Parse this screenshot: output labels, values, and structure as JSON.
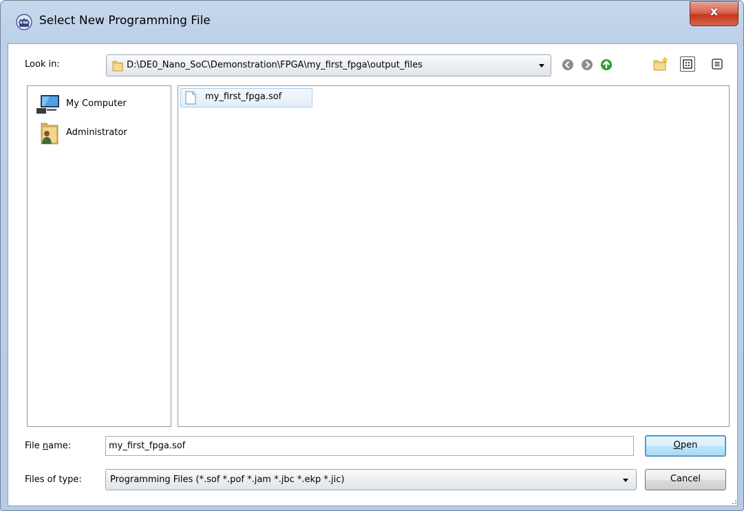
{
  "window": {
    "title": "Select New Programming File",
    "close_glyph": "x"
  },
  "toolbar": {
    "look_in_label": "Look in:",
    "path": "D:\\DE0_Nano_SoC\\Demonstration\\FPGA\\my_first_fpga\\output_files",
    "nav_icons": [
      "back-icon",
      "forward-icon",
      "up-folder-icon",
      "new-folder-icon",
      "list-view-icon",
      "detail-view-icon"
    ]
  },
  "places": [
    {
      "label": "My Computer",
      "icon": "computer-icon"
    },
    {
      "label": "Administrator",
      "icon": "user-folder-icon"
    }
  ],
  "files": [
    {
      "name": "my_first_fpga.sof",
      "icon": "file-icon",
      "selected": true
    }
  ],
  "form": {
    "file_name_label_pre": "File ",
    "file_name_label_mnemonic": "n",
    "file_name_label_post": "ame:",
    "file_name_value": "my_first_fpga.sof",
    "files_of_type_label": "Files of type:",
    "files_of_type_value": "Programming Files (*.sof *.pof *.jam *.jbc *.ekp *.jic)"
  },
  "buttons": {
    "open_mnemonic": "O",
    "open_rest": "pen",
    "cancel": "Cancel"
  },
  "colors": {
    "accent": "#3c7fb1",
    "close": "#c2381f",
    "up_arrow": "#2e9b2e"
  }
}
